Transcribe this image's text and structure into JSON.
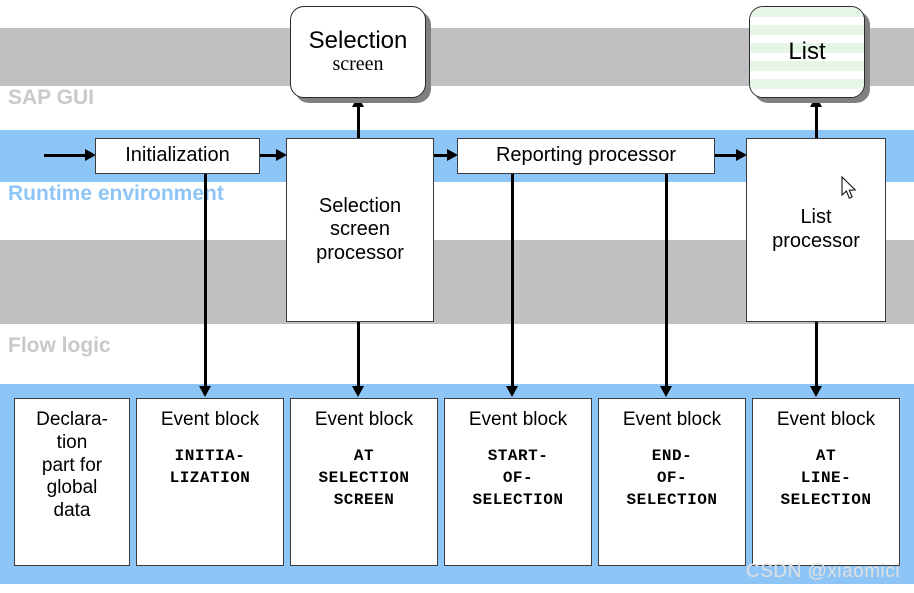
{
  "bands": [
    {
      "id": "sap-gui",
      "label": "SAP GUI",
      "color": "#c0c0c0",
      "label_color": "#c9c9c9"
    },
    {
      "id": "runtime",
      "label": "Runtime environment",
      "color": "#8ec5f7",
      "label_color": "#8ec5f7"
    },
    {
      "id": "gray2",
      "label": "",
      "color": "#c0c0c0",
      "label_color": "#c9c9c9"
    },
    {
      "id": "flow-logic",
      "label": "Flow logic",
      "color": "#8ec5f7",
      "label_color": "#c9c9c9"
    }
  ],
  "screens": {
    "selection": {
      "line1": "Selection",
      "line2": "screen"
    },
    "list": {
      "line1": "List",
      "stripe_color": "#e6f6e6"
    }
  },
  "processors": {
    "initialization": "Initialization",
    "selection_screen_processor": "Selection\nscreen\nprocessor",
    "selection_screen_processor_lines": [
      "Selection",
      "screen",
      "processor"
    ],
    "reporting_processor": "Reporting processor",
    "list_processor_lines": [
      "List",
      "processor"
    ]
  },
  "flow_blocks": [
    {
      "title_lines": [
        "Declara-",
        "tion",
        "part for",
        "global",
        "data"
      ],
      "code_lines": []
    },
    {
      "title_lines": [
        "Event block"
      ],
      "code_lines": [
        "INITIA-",
        "LIZATION"
      ]
    },
    {
      "title_lines": [
        "Event block"
      ],
      "code_lines": [
        "AT",
        "SELECTION",
        "SCREEN"
      ]
    },
    {
      "title_lines": [
        "Event block"
      ],
      "code_lines": [
        "START-",
        "OF-",
        "SELECTION"
      ]
    },
    {
      "title_lines": [
        "Event block"
      ],
      "code_lines": [
        "END-",
        "OF-",
        "SELECTION"
      ]
    },
    {
      "title_lines": [
        "Event block"
      ],
      "code_lines": [
        "AT",
        "LINE-",
        "SELECTION"
      ]
    }
  ],
  "watermark": "CSDN @xiaomici",
  "colors": {
    "band_gray": "#c0c0c0",
    "band_blue": "#8ec5f7",
    "list_stripe": "#e6f6e6",
    "line": "#000000"
  }
}
